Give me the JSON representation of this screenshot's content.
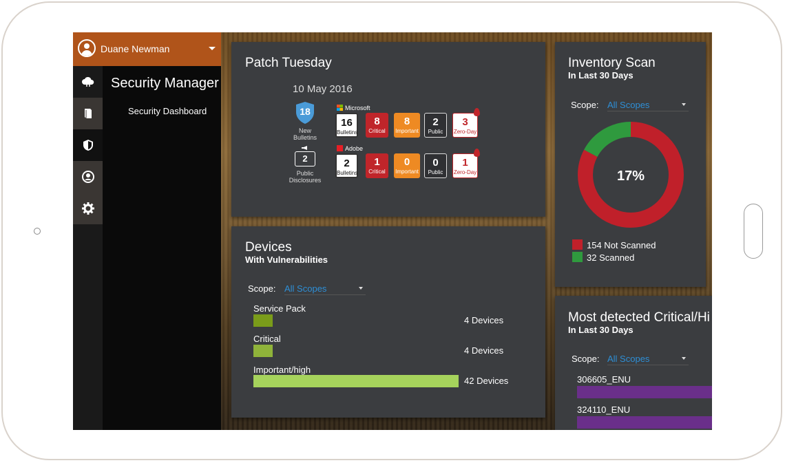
{
  "user": {
    "name": "Duane Newman"
  },
  "sidebar": {
    "icons": [
      "cloud-icon",
      "book-icon",
      "shield-icon",
      "user-circle-icon",
      "gear-icon"
    ],
    "section_title": "Security Manager",
    "links": [
      "Security Dashboard"
    ]
  },
  "patch_tuesday": {
    "title": "Patch Tuesday",
    "date": "10 May 2016",
    "new_bulletins": {
      "count": "18",
      "label_line1": "New",
      "label_line2": "Bulletins"
    },
    "public_disclosures": {
      "count": "2",
      "label_line1": "Public",
      "label_line2": "Disclosures"
    },
    "vendors": [
      {
        "name": "Microsoft",
        "bulletins": "16",
        "critical": "8",
        "important": "8",
        "public": "2",
        "zero_day": "3"
      },
      {
        "name": "Adobe",
        "bulletins": "2",
        "critical": "1",
        "important": "0",
        "public": "0",
        "zero_day": "1"
      }
    ],
    "labels": {
      "bulletins": "Bulletins",
      "critical": "Critical",
      "important": "Important",
      "public": "Public",
      "zero_day": "Zero-Day"
    }
  },
  "inventory_scan": {
    "title": "Inventory Scan",
    "subtitle": "In Last 30 Days",
    "scope_label": "Scope:",
    "scope_value": "All Scopes",
    "percent_label": "17%",
    "not_scanned": 154,
    "scanned": 32,
    "legend": [
      "154 Not Scanned",
      "32 Scanned"
    ],
    "colors": {
      "not_scanned": "#c0202a",
      "scanned": "#2f9a3e"
    }
  },
  "devices": {
    "title": "Devices",
    "subtitle": "With Vulnerabilities",
    "scope_label": "Scope:",
    "scope_value": "All Scopes",
    "rows": [
      {
        "name": "Service Pack",
        "devices": 4,
        "label": "4 Devices",
        "color": "#7a9c1a"
      },
      {
        "name": "Critical",
        "devices": 4,
        "label": "4 Devices",
        "color": "#8fb33a"
      },
      {
        "name": "Important/high",
        "devices": 42,
        "label": "42 Devices",
        "color": "#a6d35c"
      }
    ]
  },
  "most_detected": {
    "title": "Most detected Critical/Hi",
    "subtitle": "In Last 30 Days",
    "scope_label": "Scope:",
    "scope_value": "All Scopes",
    "items": [
      "306605_ENU",
      "324110_ENU"
    ]
  }
}
